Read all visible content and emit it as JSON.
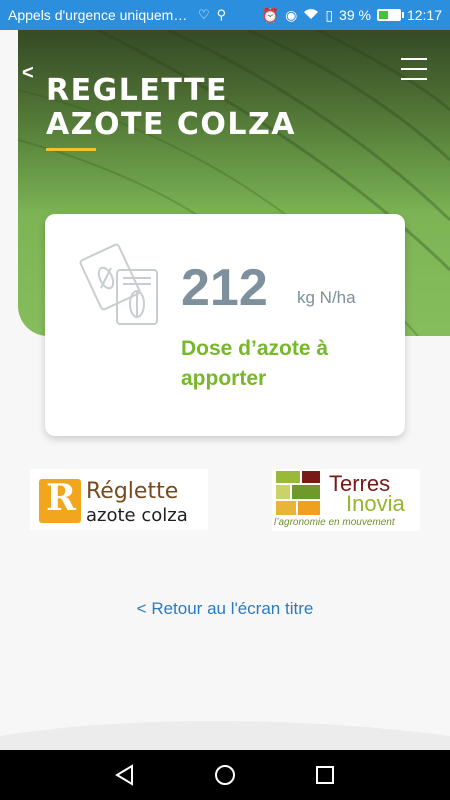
{
  "status_bar": {
    "notification_text": "Appels d'urgence uniquem…",
    "battery_percent": "39 %",
    "time": "12:17",
    "icons": [
      "heart-pulse-icon",
      "usb-icon",
      "alarm-off-icon",
      "eye-icon",
      "wifi-icon",
      "no-sim-icon",
      "battery-charging-icon"
    ]
  },
  "header": {
    "back_label": "<",
    "title_line1": "REGLETTE",
    "title_line2": "AZOTE COLZA",
    "menu_icon": "hamburger-menu-icon",
    "accent_color": "#f2c12e"
  },
  "result_card": {
    "icon": "documents-seed-icon",
    "value": "212",
    "unit": "kg N/ha",
    "label": "Dose d’azote à apporter",
    "value_color": "#7d909c",
    "label_color": "#76b82a"
  },
  "logos": {
    "reglette": {
      "letter": "R",
      "line1": "Réglette",
      "line2": "azote colza"
    },
    "terres_inovia": {
      "line1": "Terres",
      "line2": "Inovia",
      "tagline": "l’agronomie en mouvement"
    }
  },
  "back_to_title": "< Retour au l'écran titre",
  "nav": {
    "back_icon": "nav-back-triangle-icon",
    "home_icon": "nav-home-circle-icon",
    "recents_icon": "nav-recents-square-icon"
  }
}
